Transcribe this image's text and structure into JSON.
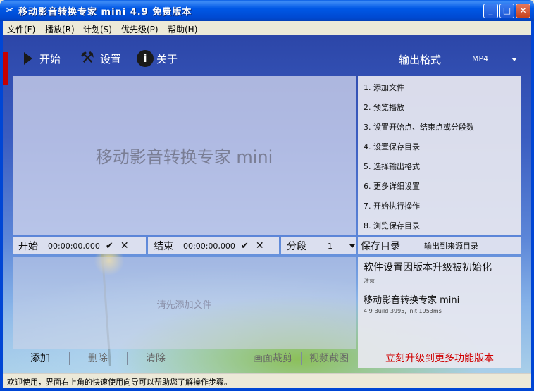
{
  "window": {
    "title": "移动影音转换专家 mini 4.9 免费版本",
    "app_icon": "scissors-icon",
    "controls": {
      "minimize": "_",
      "maximize": "□",
      "close": "✕"
    }
  },
  "menu": [
    {
      "label": "文件(F)"
    },
    {
      "label": "播放(R)"
    },
    {
      "label": "计划(S)"
    },
    {
      "label": "优先级(P)"
    },
    {
      "label": "帮助(H)"
    }
  ],
  "toolbar": {
    "start_label": "开始",
    "settings_label": "设置",
    "about_label": "关于",
    "output_format_label": "输出格式",
    "output_format_value": "MP4"
  },
  "preview": {
    "watermark": "移动影音转换专家 mini"
  },
  "steps": [
    "1. 添加文件",
    "2. 预览播放",
    "3. 设置开始点、结束点或分段数",
    "4. 设置保存目录",
    "5. 选择输出格式",
    "6. 更多详细设置",
    "7. 开始执行操作",
    "8. 浏览保存目录"
  ],
  "controls": {
    "start_label": "开始",
    "start_time": "00:00:00,000",
    "end_label": "结束",
    "end_time": "00:00:00,000",
    "segment_label": "分段",
    "segment_value": "1",
    "save_dir_label": "保存目录",
    "save_dir_value": "输出到来源目录"
  },
  "filelist": {
    "empty_text": "请先添加文件"
  },
  "info": {
    "notice_title": "软件设置因版本升级被初始化",
    "notice_sub": "注意",
    "product_name": "移动影音转换专家 mini",
    "build_info": "4.9 Build 3995, init 1953ms"
  },
  "buttons": {
    "add": "添加",
    "delete": "删除",
    "clear": "清除",
    "crop": "画面裁剪",
    "snapshot": "视频截图"
  },
  "upgrade_label": "立刻升级到更多功能版本",
  "status_text": "欢迎使用，界面右上角的快速使用向导可以帮助您了解操作步骤。"
}
